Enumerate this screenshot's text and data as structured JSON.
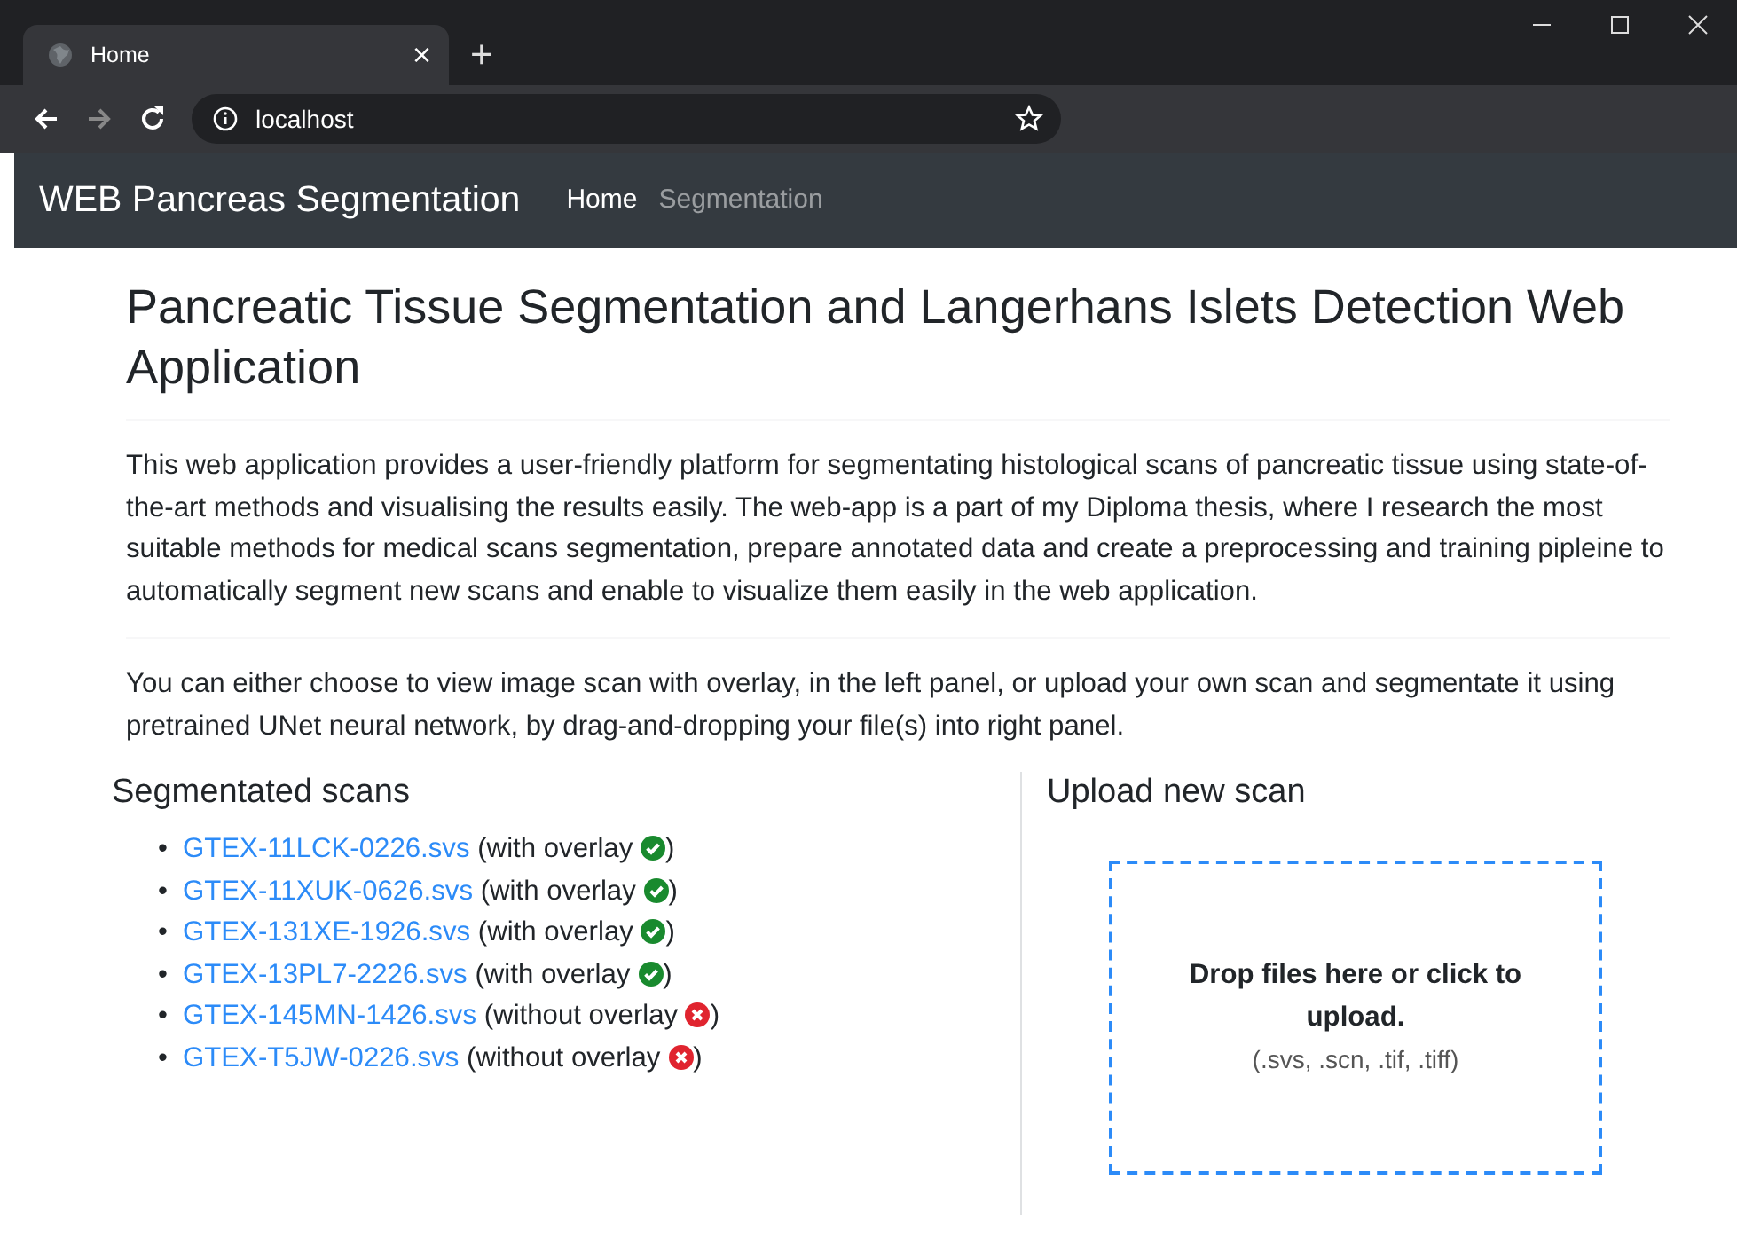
{
  "browser": {
    "tab": {
      "title": "Home",
      "close": "×"
    },
    "new_tab": "+",
    "url": "localhost"
  },
  "navbar": {
    "brand": "WEB Pancreas Segmentation",
    "links": [
      {
        "label": "Home",
        "selected": true
      },
      {
        "label": "Segmentation",
        "selected": false
      }
    ]
  },
  "title": "Pancreatic Tissue Segmentation and Langerhans Islets Detection Web Application",
  "intro": "This web application provides a user-friendly platform for segmentating histological scans of pancreatic tissue using state-of-the-art methods and visualising the results easily. The web-app is a part of my Diploma thesis, where I research the most suitable methods for medical scans segmentation, prepare annotated data and create a preprocessing and training pipleine to automatically segment new scans and enable to visualize them easily in the web application.",
  "instructions": "You can either choose to view image scan with overlay, in the left panel, or upload your own scan and segmentate it using pretrained UNet neural network, by drag-and-dropping your file(s) into right panel.",
  "scans": {
    "heading": "Segmentated scans",
    "items": [
      {
        "bullet": "•",
        "file": "GTEX-11LCK-0226.svs",
        "note": "(with overlay",
        "overlay": true,
        "end": ")"
      },
      {
        "bullet": "•",
        "file": "GTEX-11XUK-0626.svs",
        "note": "(with overlay",
        "overlay": true,
        "end": ")"
      },
      {
        "bullet": "•",
        "file": "GTEX-131XE-1926.svs",
        "note": "(with overlay",
        "overlay": true,
        "end": ")"
      },
      {
        "bullet": "•",
        "file": "GTEX-13PL7-2226.svs",
        "note": "(with overlay",
        "overlay": true,
        "end": ")"
      },
      {
        "bullet": "•",
        "file": "GTEX-145MN-1426.svs",
        "note": "(without overlay",
        "overlay": false,
        "end": ")"
      },
      {
        "bullet": "•",
        "file": "GTEX-T5JW-0226.svs",
        "note": "(without overlay",
        "overlay": false,
        "end": ")"
      }
    ]
  },
  "upload": {
    "heading": "Upload new scan",
    "message": "Drop files here or click to upload.",
    "formats": "(.svs, .scn, .tif, .tiff)"
  }
}
